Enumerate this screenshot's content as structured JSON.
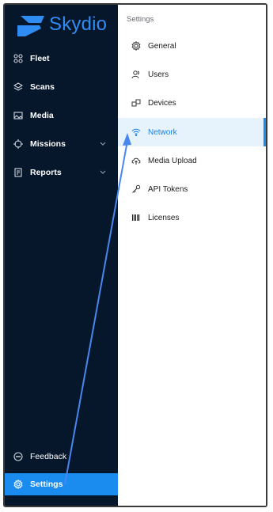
{
  "brand": {
    "name": "Skydio"
  },
  "sidebar": {
    "items": [
      {
        "label": "Fleet",
        "icon": "fleet-icon"
      },
      {
        "label": "Scans",
        "icon": "scans-icon"
      },
      {
        "label": "Media",
        "icon": "media-icon"
      },
      {
        "label": "Missions",
        "icon": "missions-icon",
        "expandable": true
      },
      {
        "label": "Reports",
        "icon": "reports-icon",
        "expandable": true
      }
    ],
    "bottom": [
      {
        "label": "Feedback",
        "icon": "feedback-icon"
      },
      {
        "label": "Settings",
        "icon": "settings-icon",
        "active": true
      }
    ]
  },
  "settings": {
    "title": "Settings",
    "items": [
      {
        "label": "General",
        "icon": "gear-icon"
      },
      {
        "label": "Users",
        "icon": "users-icon"
      },
      {
        "label": "Devices",
        "icon": "devices-icon"
      },
      {
        "label": "Network",
        "icon": "wifi-icon",
        "active": true
      },
      {
        "label": "Media Upload",
        "icon": "cloud-upload-icon"
      },
      {
        "label": "API Tokens",
        "icon": "key-icon"
      },
      {
        "label": "Licenses",
        "icon": "barcode-icon"
      }
    ]
  },
  "colors": {
    "sidebar_bg": "#06162b",
    "accent": "#1a8cf0",
    "active_row_bg": "#e6f3fd",
    "arrow": "#4a86f0"
  }
}
